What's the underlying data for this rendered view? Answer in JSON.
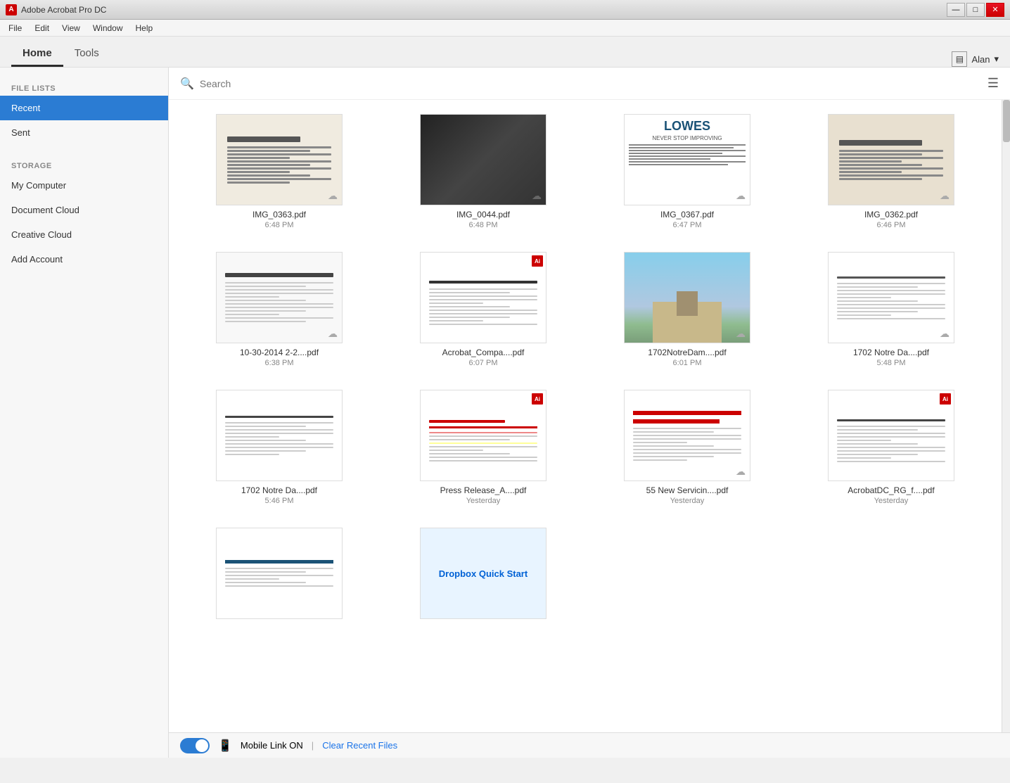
{
  "titleBar": {
    "icon": "A",
    "title": "Adobe Acrobat Pro DC",
    "buttons": {
      "minimize": "—",
      "maximize": "□",
      "close": "✕"
    }
  },
  "menuBar": {
    "items": [
      "File",
      "Edit",
      "View",
      "Window",
      "Help"
    ]
  },
  "tabs": {
    "home": "Home",
    "tools": "Tools",
    "active": "home"
  },
  "user": {
    "name": "Alan",
    "icon": "▤"
  },
  "search": {
    "placeholder": "Search",
    "listViewIcon": "☰"
  },
  "sidebar": {
    "fileLists": {
      "label": "FILE LISTS",
      "items": [
        "Recent",
        "Sent"
      ]
    },
    "storage": {
      "label": "STORAGE",
      "items": [
        "My Computer",
        "Document Cloud",
        "Creative Cloud",
        "Add Account"
      ]
    }
  },
  "files": [
    {
      "name": "IMG_0363.pdf",
      "time": "6:48 PM",
      "cloud": true,
      "type": "receipt",
      "hasAdobe": false
    },
    {
      "name": "IMG_0044.pdf",
      "time": "6:48 PM",
      "cloud": true,
      "type": "darkphoto",
      "hasAdobe": false
    },
    {
      "name": "IMG_0367.pdf",
      "time": "6:47 PM",
      "cloud": true,
      "type": "lowes",
      "hasAdobe": false
    },
    {
      "name": "IMG_0362.pdf",
      "time": "6:46 PM",
      "cloud": true,
      "type": "receipt2",
      "hasAdobe": false
    },
    {
      "name": "10-30-2014 2-2....pdf",
      "time": "6:38 PM",
      "cloud": true,
      "type": "textdoc",
      "hasAdobe": false
    },
    {
      "name": "Acrobat_Compa....pdf",
      "time": "6:07 PM",
      "cloud": false,
      "type": "acrobatdoc",
      "hasAdobe": true
    },
    {
      "name": "1702NotreDam....pdf",
      "time": "6:01 PM",
      "cloud": true,
      "type": "building",
      "hasAdobe": false
    },
    {
      "name": "1702 Notre Da....pdf",
      "time": "5:48 PM",
      "cloud": true,
      "type": "textdoc2",
      "hasAdobe": false
    },
    {
      "name": "1702 Notre Da....pdf",
      "time": "5:46 PM",
      "cloud": false,
      "type": "textdoc3",
      "hasAdobe": false
    },
    {
      "name": "Press Release_A....pdf",
      "time": "Yesterday",
      "cloud": false,
      "type": "pressrelease",
      "hasAdobe": true
    },
    {
      "name": "55 New Servicin....pdf",
      "time": "Yesterday",
      "cloud": true,
      "type": "servicin",
      "hasAdobe": false
    },
    {
      "name": "AcrobatDC_RG_f....pdf",
      "time": "Yesterday",
      "cloud": false,
      "type": "acrobatdc",
      "hasAdobe": true
    },
    {
      "name": "",
      "time": "",
      "cloud": false,
      "type": "smalldoc",
      "hasAdobe": false
    },
    {
      "name": "Dropbox Quick Start",
      "time": "",
      "cloud": false,
      "type": "dropbox",
      "hasAdobe": false
    }
  ],
  "bottomBar": {
    "mobileLinkLabel": "Mobile Link ON",
    "separator": "|",
    "clearLabel": "Clear Recent Files",
    "toggleOn": true
  }
}
